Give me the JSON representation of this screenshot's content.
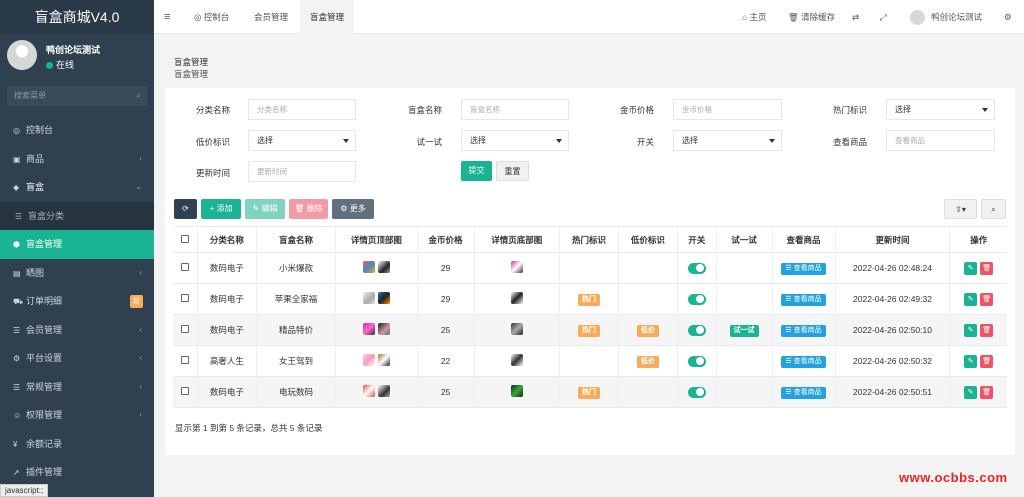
{
  "app": {
    "brand": "盲盒商城V4.0"
  },
  "user": {
    "name": "鸭创论坛测试",
    "status": "在线"
  },
  "sidebar": {
    "search_placeholder": "搜索菜单",
    "items": [
      {
        "label": "控制台",
        "icon": "dashboard-icon"
      },
      {
        "label": "商品",
        "icon": "cube-icon",
        "arrow": "‹"
      },
      {
        "label": "盲盒",
        "icon": "box-icon",
        "arrow": "⌄"
      },
      {
        "label": "盲盒分类",
        "icon": "list-icon"
      },
      {
        "label": "盲盒管理",
        "icon": "cubes-icon"
      },
      {
        "label": "晒图",
        "icon": "image-icon",
        "arrow": "‹"
      },
      {
        "label": "订单明细",
        "icon": "cart-icon",
        "badge": "新"
      },
      {
        "label": "会员管理",
        "icon": "list-icon",
        "arrow": "‹"
      },
      {
        "label": "平台设置",
        "icon": "gear-icon",
        "arrow": "‹"
      },
      {
        "label": "常规管理",
        "icon": "list-icon",
        "arrow": "‹"
      },
      {
        "label": "权限管理",
        "icon": "users-icon",
        "arrow": "‹"
      },
      {
        "label": "余额记录",
        "icon": "yen-icon"
      },
      {
        "label": "插件管理",
        "icon": "rocket-icon"
      }
    ],
    "status_bar": "javascript:;"
  },
  "topbar": {
    "menu_icon": "≡",
    "tabs": [
      "控制台",
      "会员管理",
      "盲盒管理"
    ],
    "right": {
      "home": "主页",
      "clear_cache": "清除缓存",
      "user": "鸭创论坛测试"
    }
  },
  "panel": {
    "title": "盲盒管理",
    "subtitle": "盲盒管理"
  },
  "filters": {
    "category_label": "分类名称",
    "category_placeholder": "分类名称",
    "name_label": "盲盒名称",
    "name_placeholder": "盲盒名称",
    "price_label": "金币价格",
    "price_placeholder": "金币价格",
    "hot_label": "热门标识",
    "hot_value": "选择",
    "low_label": "低价标识",
    "low_value": "选择",
    "try_label": "试一试",
    "try_value": "选择",
    "switch_label": "开关",
    "switch_value": "选择",
    "view_label": "查看商品",
    "view_placeholder": "查看商品",
    "time_label": "更新时间",
    "time_placeholder": "更新时间",
    "submit": "提交",
    "reset": "重置"
  },
  "toolbar": {
    "add": "添加",
    "edit": "编辑",
    "delete": "删除",
    "more": "更多"
  },
  "table": {
    "columns": [
      "分类名称",
      "盲盒名称",
      "详情页顶部图",
      "金币价格",
      "详情页底部图",
      "热门标识",
      "低价标识",
      "开关",
      "试一试",
      "查看商品",
      "更新时间",
      "操作"
    ],
    "rows": [
      {
        "category": "数码电子",
        "name": "小米爆款",
        "price": "29",
        "hot": "",
        "low": "",
        "try": "",
        "view": "查看商品",
        "time": "2022-04-26 02:48:24"
      },
      {
        "category": "数码电子",
        "name": "苹果全家福",
        "price": "29",
        "hot": "热门",
        "low": "",
        "try": "",
        "view": "查看商品",
        "time": "2022-04-26 02:49:32"
      },
      {
        "category": "数码电子",
        "name": "精品特价",
        "price": "25",
        "hot": "热门",
        "low": "低价",
        "try": "试一试",
        "view": "查看商品",
        "time": "2022-04-26 02:50:10"
      },
      {
        "category": "高奢人生",
        "name": "女王驾到",
        "price": "22",
        "hot": "",
        "low": "低价",
        "try": "",
        "view": "查看商品",
        "time": "2022-04-26 02:50:32"
      },
      {
        "category": "数码电子",
        "name": "电玩数码",
        "price": "25",
        "hot": "热门",
        "low": "",
        "try": "",
        "view": "查看商品",
        "time": "2022-04-26 02:50:51"
      }
    ],
    "footer": "显示第 1 到第 5 条记录，总共 5 条记录"
  },
  "watermark": "www.ocbbs.com",
  "colors": {
    "accent": "#1ab394",
    "sidebar": "#2f4050",
    "hot": "#f8ac59",
    "info": "#23a1e0",
    "danger": "#ed5565"
  }
}
